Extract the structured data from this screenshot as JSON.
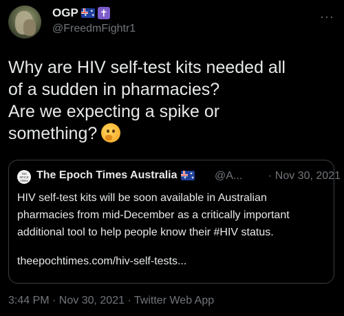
{
  "author": {
    "display_name": "OGP",
    "handle": "@FreedmFightr1"
  },
  "tweet": {
    "line1": "Why are HIV self-test kits needed all",
    "line2": "of a sudden in pharmacies?",
    "line3": "Are we expecting a spike or",
    "line4": "something?"
  },
  "quoted_tweet": {
    "source_name": "The Epoch Times Australia",
    "handle": "@A...",
    "date": "· Nov 30, 2021",
    "text_line1": "HIV self-test kits will be soon available in Australian",
    "text_line2": "pharmacies from mid-December as a critically important",
    "text_line3": "additional tool to help people know their #HIV status.",
    "link": "theepochtimes.com/hiv-self-tests..."
  },
  "meta": {
    "timestamp": "3:44 PM · Nov 30, 2021 · Twitter Web App"
  },
  "icons": {
    "more": "more-icon",
    "flag": "australia-flag-icon",
    "cross": "cross-icon",
    "emoji": "thinking-face-emoji"
  },
  "colors": {
    "background": "#000000",
    "text": "#e7e9ea",
    "secondary": "#71767b",
    "border": "#3a3e42"
  },
  "logo_text": "THE EPOCH TIMES"
}
